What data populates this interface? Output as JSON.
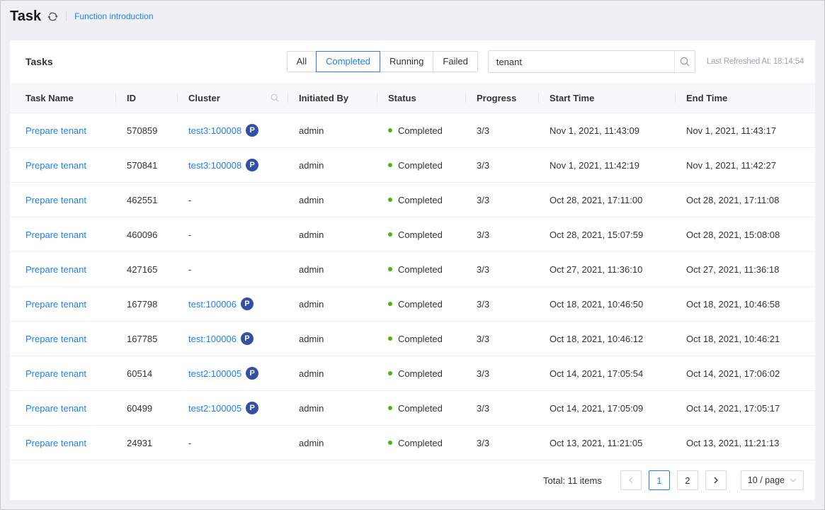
{
  "header": {
    "title": "Task",
    "intro_link": "Function introduction"
  },
  "panel": {
    "title": "Tasks",
    "filters": [
      {
        "label": "All",
        "active": false
      },
      {
        "label": "Completed",
        "active": true
      },
      {
        "label": "Running",
        "active": false
      },
      {
        "label": "Failed",
        "active": false
      }
    ],
    "search_value": "tenant",
    "last_refreshed": "Last Refreshed At: 18:14:54"
  },
  "table": {
    "columns": [
      {
        "label": "Task Name"
      },
      {
        "label": "ID"
      },
      {
        "label": "Cluster",
        "search_icon": true
      },
      {
        "label": "Initiated By"
      },
      {
        "label": "Status"
      },
      {
        "label": "Progress"
      },
      {
        "label": "Start Time"
      },
      {
        "label": "End Time"
      }
    ],
    "rows": [
      {
        "task_name": "Prepare tenant",
        "id": "570859",
        "cluster": "test3:100008",
        "cluster_badge": "P",
        "initiated_by": "admin",
        "status": "Completed",
        "progress": "3/3",
        "start_time": "Nov 1, 2021, 11:43:09",
        "end_time": "Nov 1, 2021, 11:43:17"
      },
      {
        "task_name": "Prepare tenant",
        "id": "570841",
        "cluster": "test3:100008",
        "cluster_badge": "P",
        "initiated_by": "admin",
        "status": "Completed",
        "progress": "3/3",
        "start_time": "Nov 1, 2021, 11:42:19",
        "end_time": "Nov 1, 2021, 11:42:27"
      },
      {
        "task_name": "Prepare tenant",
        "id": "462551",
        "cluster": "-",
        "cluster_badge": null,
        "initiated_by": "admin",
        "status": "Completed",
        "progress": "3/3",
        "start_time": "Oct 28, 2021, 17:11:00",
        "end_time": "Oct 28, 2021, 17:11:08"
      },
      {
        "task_name": "Prepare tenant",
        "id": "460096",
        "cluster": "-",
        "cluster_badge": null,
        "initiated_by": "admin",
        "status": "Completed",
        "progress": "3/3",
        "start_time": "Oct 28, 2021, 15:07:59",
        "end_time": "Oct 28, 2021, 15:08:08"
      },
      {
        "task_name": "Prepare tenant",
        "id": "427165",
        "cluster": "-",
        "cluster_badge": null,
        "initiated_by": "admin",
        "status": "Completed",
        "progress": "3/3",
        "start_time": "Oct 27, 2021, 11:36:10",
        "end_time": "Oct 27, 2021, 11:36:18"
      },
      {
        "task_name": "Prepare tenant",
        "id": "167798",
        "cluster": "test:100006",
        "cluster_badge": "P",
        "initiated_by": "admin",
        "status": "Completed",
        "progress": "3/3",
        "start_time": "Oct 18, 2021, 10:46:50",
        "end_time": "Oct 18, 2021, 10:46:58"
      },
      {
        "task_name": "Prepare tenant",
        "id": "167785",
        "cluster": "test:100006",
        "cluster_badge": "P",
        "initiated_by": "admin",
        "status": "Completed",
        "progress": "3/3",
        "start_time": "Oct 18, 2021, 10:46:12",
        "end_time": "Oct 18, 2021, 10:46:21"
      },
      {
        "task_name": "Prepare tenant",
        "id": "60514",
        "cluster": "test2:100005",
        "cluster_badge": "P",
        "initiated_by": "admin",
        "status": "Completed",
        "progress": "3/3",
        "start_time": "Oct 14, 2021, 17:05:54",
        "end_time": "Oct 14, 2021, 17:06:02"
      },
      {
        "task_name": "Prepare tenant",
        "id": "60499",
        "cluster": "test2:100005",
        "cluster_badge": "P",
        "initiated_by": "admin",
        "status": "Completed",
        "progress": "3/3",
        "start_time": "Oct 14, 2021, 17:05:09",
        "end_time": "Oct 14, 2021, 17:05:17"
      },
      {
        "task_name": "Prepare tenant",
        "id": "24931",
        "cluster": "-",
        "cluster_badge": null,
        "initiated_by": "admin",
        "status": "Completed",
        "progress": "3/3",
        "start_time": "Oct 13, 2021, 11:21:05",
        "end_time": "Oct 13, 2021, 11:21:13"
      }
    ]
  },
  "pagination": {
    "total_label": "Total: 11 items",
    "pages": [
      "1",
      "2"
    ],
    "current_page": "1",
    "page_size_label": "10 / page"
  },
  "colors": {
    "accent": "#2080f0",
    "badge_bg": "#3350a2",
    "status_dot": "#49b512"
  }
}
